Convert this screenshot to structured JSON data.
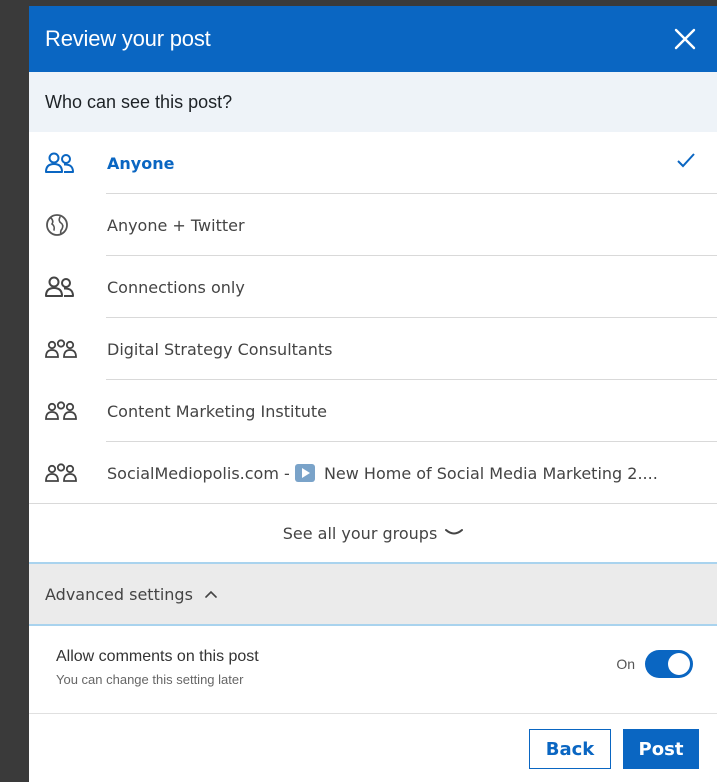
{
  "header": {
    "title": "Review your post"
  },
  "visibility": {
    "question": "Who can see this post?",
    "options": [
      {
        "label": "Anyone",
        "icon": "people-icon",
        "selected": true
      },
      {
        "label": "Anyone + Twitter",
        "icon": "globe-icon",
        "selected": false
      },
      {
        "label": "Connections only",
        "icon": "people-icon",
        "selected": false
      },
      {
        "label": "Digital Strategy Consultants",
        "icon": "group-icon",
        "selected": false
      },
      {
        "label": "Content Marketing Institute",
        "icon": "group-icon",
        "selected": false
      },
      {
        "label_prefix": "SocialMediopolis.com - ",
        "label_suffix": " New Home of Social Media Marketing 2....",
        "icon": "group-icon",
        "badge": "play-badge-icon",
        "selected": false
      }
    ],
    "see_all": "See all your groups"
  },
  "advanced": {
    "label": "Advanced settings",
    "comments": {
      "title": "Allow comments on this post",
      "subtitle": "You can change this setting later",
      "state": "On",
      "enabled": true
    }
  },
  "footer": {
    "back_label": "Back",
    "post_label": "Post"
  },
  "colors": {
    "accent": "#0a66c2",
    "header_bg": "#0a66c2",
    "section_bg": "#eef3f8"
  }
}
